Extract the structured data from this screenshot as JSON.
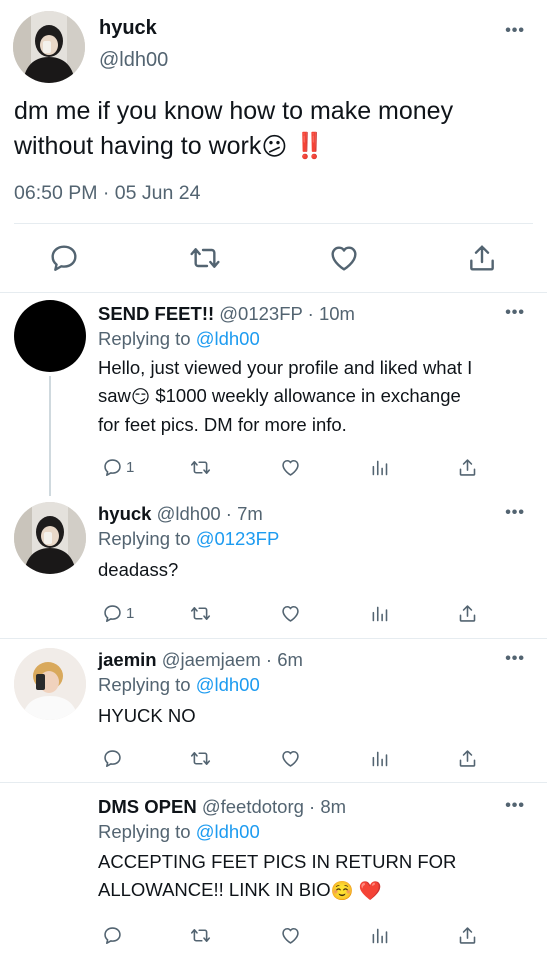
{
  "main_tweet": {
    "name": "hyuck",
    "handle": "@ldh00",
    "text": "dm me if you know how to make money without having to work",
    "emoji": "😕",
    "exclamation": "‼️",
    "timestamp": "06:50 PM · 05 Jun 24",
    "actions": [
      "reply-icon",
      "retweet-icon",
      "like-icon",
      "share-icon"
    ]
  },
  "replies": [
    {
      "name": "SEND FEET!!",
      "handle": "@0123FP",
      "time": "10m",
      "replying_prefix": "Replying to",
      "replying_to": "@ldh00",
      "text_line1": "Hello, just viewed your profile and liked what I",
      "text_line2a": "saw",
      "text_emoji": "😏",
      "text_line2b": " $1000 weekly allowance in exchange",
      "text_line3": "for feet pics. DM for more info.",
      "reply_count": "1"
    },
    {
      "name": "hyuck",
      "handle": "@ldh00",
      "time": "7m",
      "replying_prefix": "Replying to",
      "replying_to": "@0123FP",
      "text": "deadass?",
      "reply_count": "1"
    },
    {
      "name": "jaemin",
      "handle": "@jaemjaem",
      "time": "6m",
      "replying_prefix": "Replying to",
      "replying_to": "@ldh00",
      "text": "HYUCK NO",
      "reply_count": ""
    },
    {
      "name": "DMS OPEN",
      "handle": "@feetdotorg",
      "time": "8m",
      "replying_prefix": "Replying to",
      "replying_to": "@ldh00",
      "text_line1": "ACCEPTING FEET PICS IN RETURN FOR",
      "text_line2": "ALLOWANCE!! LINK IN BIO",
      "text_emoji": "☺️",
      "text_heart": "❤️",
      "reply_count": ""
    }
  ],
  "colors": {
    "link": "#1d9bf0",
    "secondary_text": "#536471",
    "divider": "#e6ecf0",
    "exclamation_red": "#e0245e"
  }
}
